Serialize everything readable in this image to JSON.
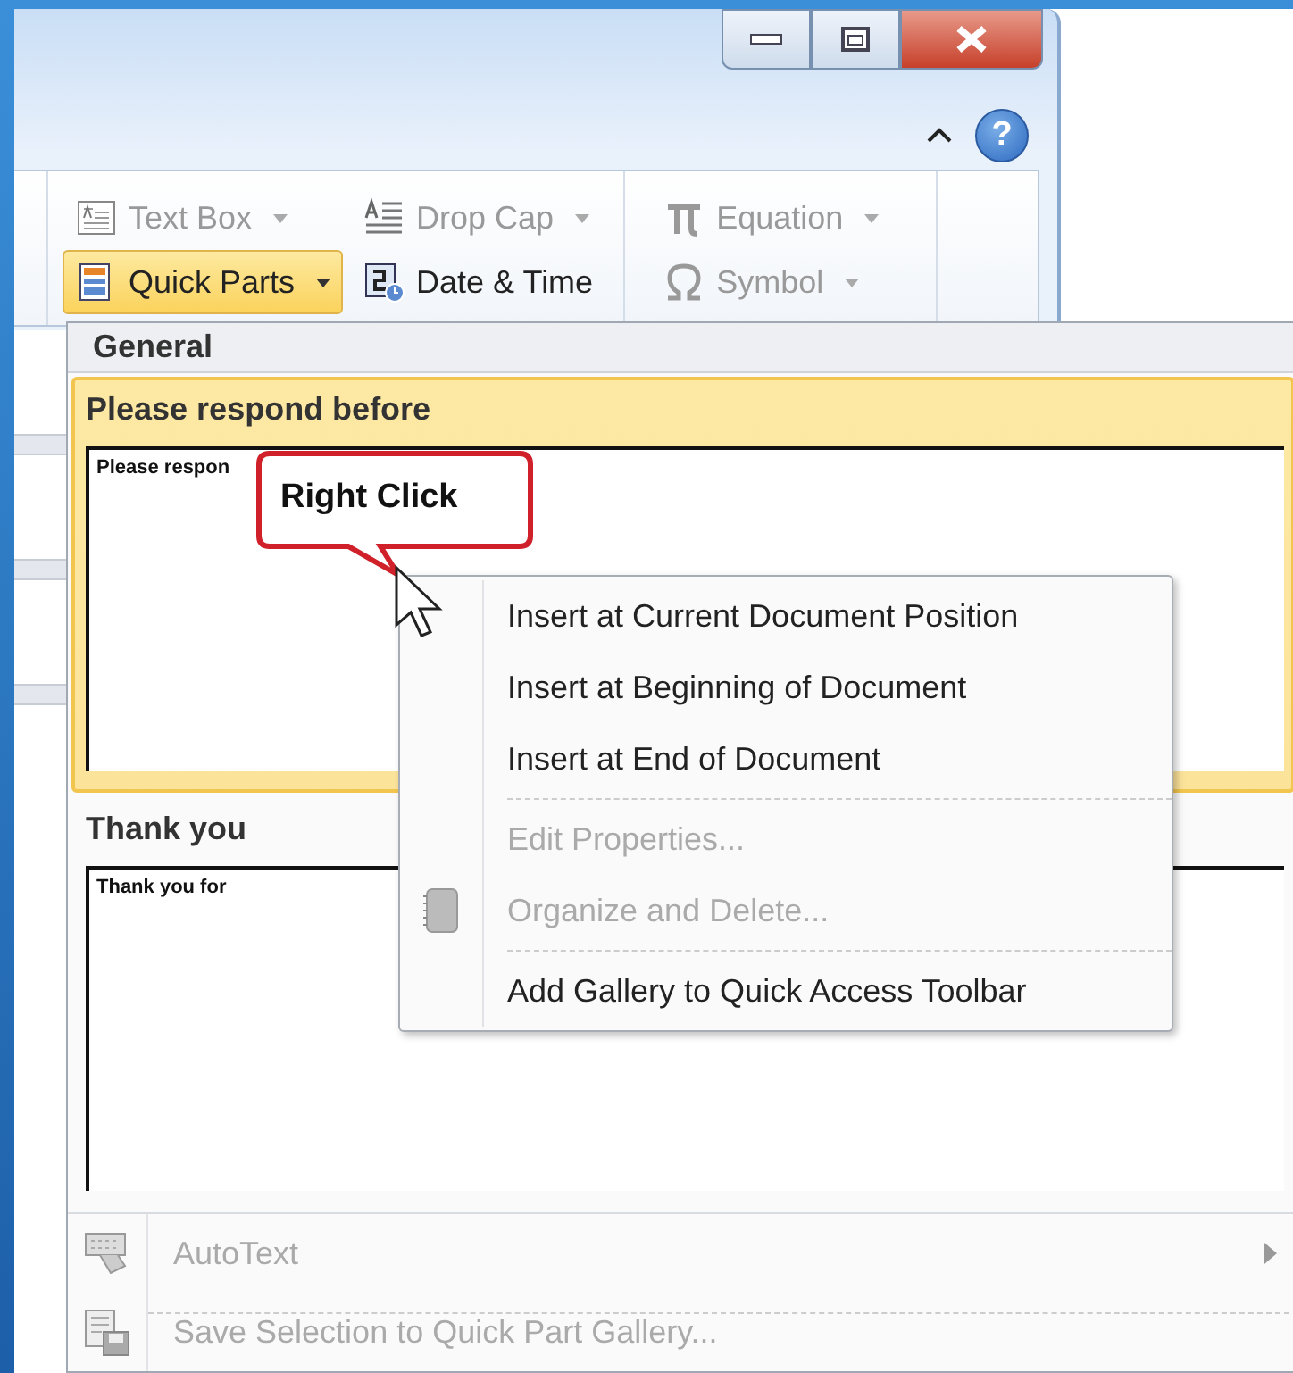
{
  "window": {
    "help": "?"
  },
  "ribbon": {
    "groups": [
      {
        "buttons": [
          {
            "label": "Text Box",
            "disabled": true,
            "selected": false,
            "has_menu": true
          },
          {
            "label": "Drop Cap",
            "disabled": true,
            "selected": false,
            "has_menu": true
          },
          {
            "label": "Quick Parts",
            "disabled": false,
            "selected": true,
            "has_menu": true
          },
          {
            "label": "Date & Time",
            "disabled": false,
            "selected": false,
            "has_menu": false
          }
        ]
      },
      {
        "buttons": [
          {
            "label": "Equation",
            "disabled": true,
            "selected": false,
            "has_menu": true
          },
          {
            "label": "Symbol",
            "disabled": true,
            "selected": false,
            "has_menu": true
          }
        ]
      }
    ]
  },
  "gallery": {
    "header": "General",
    "items": [
      {
        "title": "Please respond before",
        "preview": "Please respon",
        "selected": true
      },
      {
        "title": "Thank you",
        "preview": "Thank you for",
        "selected": false
      }
    ],
    "commands": [
      {
        "label": "AutoText",
        "disabled": true,
        "submenu": true
      },
      {
        "label": "Save Selection to Quick Part Gallery...",
        "disabled": true,
        "submenu": false
      }
    ]
  },
  "callout": {
    "text": "Right Click"
  },
  "context_menu": {
    "items": [
      {
        "kind": "item",
        "label": "Insert at Current Document Position",
        "disabled": false
      },
      {
        "kind": "item",
        "label": "Insert at Beginning of Document",
        "disabled": false
      },
      {
        "kind": "item",
        "label": "Insert at End of Document",
        "disabled": false
      },
      {
        "kind": "separator"
      },
      {
        "kind": "item",
        "label": "Edit Properties...",
        "disabled": true
      },
      {
        "kind": "item",
        "label": "Organize and Delete...",
        "disabled": true
      },
      {
        "kind": "separator"
      },
      {
        "kind": "item",
        "label": "Add Gallery to Quick Access Toolbar",
        "disabled": false
      }
    ]
  }
}
